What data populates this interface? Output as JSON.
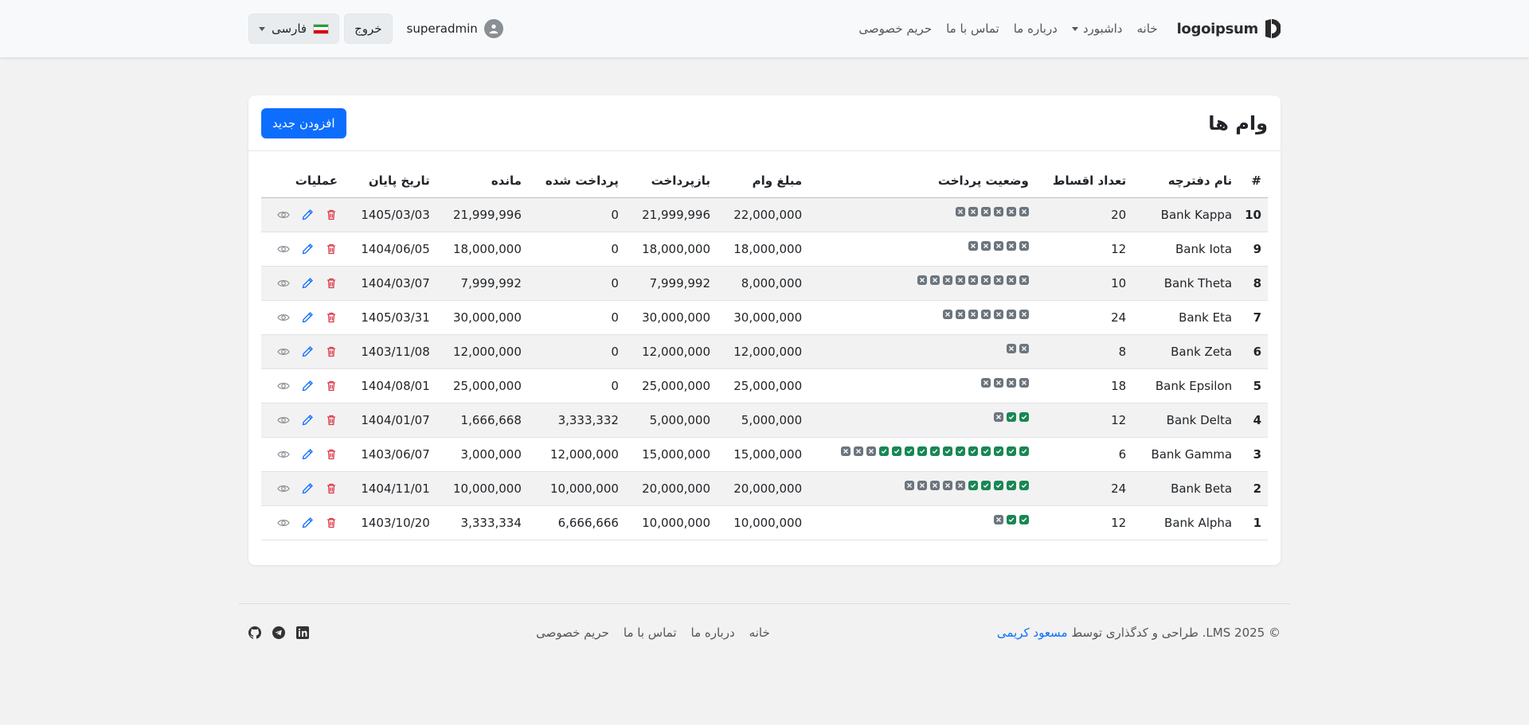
{
  "navbar": {
    "logo_text": "logoipsum",
    "links": [
      "خانه",
      "داشبورد",
      "درباره ما",
      "تماس با ما",
      "حریم خصوصی"
    ],
    "username": "superadmin",
    "logout_label": "خروج",
    "language_label": "فارسی"
  },
  "card": {
    "title": "وام ها",
    "add_button": "افزودن جدید"
  },
  "table": {
    "headers": [
      "#",
      "نام دفترچه",
      "تعداد اقساط",
      "وضعیت پرداخت",
      "مبلغ وام",
      "بازپرداخت",
      "پرداخت شده",
      "مانده",
      "تاریخ پایان",
      "عملیات"
    ],
    "rows": [
      {
        "id": "10",
        "name": "Bank Kappa",
        "installments": "20",
        "status": {
          "paid": 0,
          "unpaid": 6
        },
        "amount": "22,000,000",
        "repayment": "21,999,996",
        "paid": "0",
        "remaining": "21,999,996",
        "end_date": "1405/03/03"
      },
      {
        "id": "9",
        "name": "Bank Iota",
        "installments": "12",
        "status": {
          "paid": 0,
          "unpaid": 5
        },
        "amount": "18,000,000",
        "repayment": "18,000,000",
        "paid": "0",
        "remaining": "18,000,000",
        "end_date": "1404/06/05"
      },
      {
        "id": "8",
        "name": "Bank Theta",
        "installments": "10",
        "status": {
          "paid": 0,
          "unpaid": 9
        },
        "amount": "8,000,000",
        "repayment": "7,999,992",
        "paid": "0",
        "remaining": "7,999,992",
        "end_date": "1404/03/07"
      },
      {
        "id": "7",
        "name": "Bank Eta",
        "installments": "24",
        "status": {
          "paid": 0,
          "unpaid": 7
        },
        "amount": "30,000,000",
        "repayment": "30,000,000",
        "paid": "0",
        "remaining": "30,000,000",
        "end_date": "1405/03/31"
      },
      {
        "id": "6",
        "name": "Bank Zeta",
        "installments": "8",
        "status": {
          "paid": 0,
          "unpaid": 2
        },
        "amount": "12,000,000",
        "repayment": "12,000,000",
        "paid": "0",
        "remaining": "12,000,000",
        "end_date": "1403/11/08"
      },
      {
        "id": "5",
        "name": "Bank Epsilon",
        "installments": "18",
        "status": {
          "paid": 0,
          "unpaid": 4
        },
        "amount": "25,000,000",
        "repayment": "25,000,000",
        "paid": "0",
        "remaining": "25,000,000",
        "end_date": "1404/08/01"
      },
      {
        "id": "4",
        "name": "Bank Delta",
        "installments": "12",
        "status": {
          "paid": 2,
          "unpaid": 1
        },
        "amount": "5,000,000",
        "repayment": "5,000,000",
        "paid": "3,333,332",
        "remaining": "1,666,668",
        "end_date": "1404/01/07"
      },
      {
        "id": "3",
        "name": "Bank Gamma",
        "installments": "6",
        "status": {
          "paid": 12,
          "unpaid": 3
        },
        "amount": "15,000,000",
        "repayment": "15,000,000",
        "paid": "12,000,000",
        "remaining": "3,000,000",
        "end_date": "1403/06/07"
      },
      {
        "id": "2",
        "name": "Bank Beta",
        "installments": "24",
        "status": {
          "paid": 5,
          "unpaid": 5
        },
        "amount": "20,000,000",
        "repayment": "20,000,000",
        "paid": "10,000,000",
        "remaining": "10,000,000",
        "end_date": "1404/11/01"
      },
      {
        "id": "1",
        "name": "Bank Alpha",
        "installments": "12",
        "status": {
          "paid": 2,
          "unpaid": 1
        },
        "amount": "10,000,000",
        "repayment": "10,000,000",
        "paid": "6,666,666",
        "remaining": "3,333,334",
        "end_date": "1403/10/20"
      }
    ]
  },
  "footer": {
    "copyright_prefix": "© 2025 LMS. طراحی و کدگذاری توسط",
    "author": "مسعود کریمی",
    "links": [
      "خانه",
      "درباره ما",
      "تماس با ما",
      "حریم خصوصی"
    ],
    "social_icons": [
      "github-icon",
      "telegram-icon",
      "linkedin-icon"
    ]
  },
  "colors": {
    "primary": "#0d6efd",
    "paid_status": "#198754",
    "unpaid_status": "#6c757d",
    "delete_icon": "#dc3545",
    "edit_icon": "#0d6efd",
    "view_icon": "#6c757d"
  }
}
